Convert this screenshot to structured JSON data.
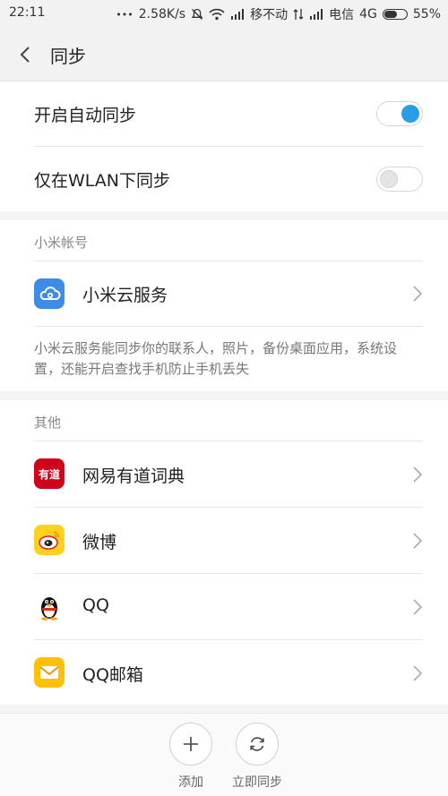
{
  "status_bar": {
    "time": "22:11",
    "dots": "•••",
    "speed": "2.58K/s",
    "carrier1": "移不动",
    "carrier2": "电信",
    "network": "4G",
    "battery": "55%"
  },
  "header": {
    "title": "同步",
    "back_icon": "chevron-left-icon"
  },
  "sync_settings": {
    "auto_sync": {
      "label": "开启自动同步",
      "enabled": true
    },
    "wlan_only": {
      "label": "仅在WLAN下同步",
      "enabled": false
    }
  },
  "mi_account": {
    "heading": "小米帐号",
    "item": {
      "label": "小米云服务",
      "icon": "cloud-icon"
    },
    "description": "小米云服务能同步你的联系人，照片，备份桌面应用，系统设置，还能开启查找手机防止手机丢失"
  },
  "others": {
    "heading": "其他",
    "items": [
      {
        "label": "网易有道词典",
        "icon": "youdao-dictionary-icon",
        "icon_text": "有道"
      },
      {
        "label": "微博",
        "icon": "weibo-icon"
      },
      {
        "label": "QQ",
        "icon": "qq-penguin-icon"
      },
      {
        "label": "QQ邮箱",
        "icon": "qq-mail-icon"
      }
    ]
  },
  "bottom_bar": {
    "add": {
      "label": "添加",
      "icon": "plus-icon"
    },
    "sync_now": {
      "label": "立即同步",
      "icon": "refresh-icon"
    }
  },
  "colors": {
    "accent": "#2a9de9",
    "youdao_red": "#d0021b",
    "weibo_yellow": "#ffd21f",
    "mail_yellow": "#ffc107"
  }
}
